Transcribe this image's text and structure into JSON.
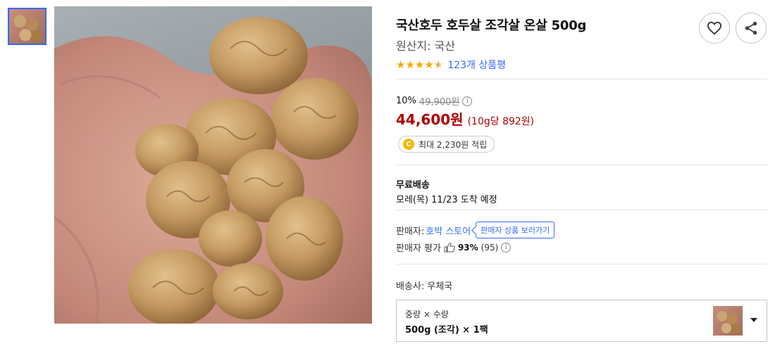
{
  "product": {
    "title": "국산호두 호두살 조각살 온살 500g",
    "origin": "원산지: 국산",
    "rating_value": 4.5,
    "review_link": "123개 상품평"
  },
  "price": {
    "discount_rate": "10%",
    "original_price": "49,900원",
    "sale_price": "44,600원",
    "unit_price": "(10g당 892원)"
  },
  "reward": {
    "coin_symbol": "C",
    "text": "최대 2,230원 적립"
  },
  "shipping": {
    "title": "무료배송",
    "arrival": "모레(목) 11/23 도착 예정"
  },
  "seller": {
    "label": "판매자:",
    "name": "호박 스토어",
    "tooltip": "판매자 상품 보러가기",
    "rating_label": "판매자 평가",
    "score": "93%",
    "count": "(95)"
  },
  "carrier": "배송사: 우체국",
  "option": {
    "label": "중량 × 수량",
    "value": "500g (조각) × 1팩"
  },
  "colors": {
    "accent": "#346aff",
    "price": "#ae0000",
    "star": "#f4a800",
    "coin": "#f5b800"
  },
  "icons": [
    "heart-icon",
    "share-icon",
    "info-icon",
    "thumbs-up-icon",
    "chevron-down-icon",
    "coin-icon",
    "star-icon"
  ]
}
